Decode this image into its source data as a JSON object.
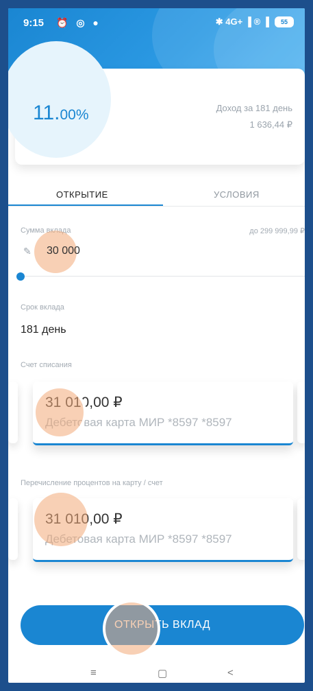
{
  "status_bar": {
    "time": "9:15",
    "left_icons": "⏰ ◎ ●",
    "right_icons": "✱ 4G+ ▐ ® ▐",
    "battery": "55"
  },
  "header": {
    "back_icon": "arrow-left-icon"
  },
  "rate_card": {
    "rate_value": "11.",
    "rate_suffix": "00%",
    "income_label": "Доход за 181 день",
    "income_value": "1 636,44 ₽"
  },
  "tabs": [
    {
      "label": "ОТКРЫТИЕ",
      "active": true
    },
    {
      "label": "УСЛОВИЯ",
      "active": false
    }
  ],
  "deposit": {
    "amount_label": "Сумма вклада",
    "amount_max": "до 299 999,99 ₽",
    "amount_value": "30 000",
    "term_label": "Срок вклада",
    "term_value": "181 день"
  },
  "debit_account": {
    "label": "Счет списания",
    "amount": "31 010,00 ₽",
    "description": "Дебетовая карта МИР *8597 *8597"
  },
  "interest_account": {
    "label": "Перечисление процентов на карту / счет",
    "amount": "31 010,00 ₽",
    "description": "Дебетовая карта МИР *8597 *8597"
  },
  "open_button": {
    "label": "ОТКРЫТЬ ВКЛАД"
  },
  "nav_bar": {
    "menu": "≡",
    "home": "▢",
    "back": "<"
  },
  "colors": {
    "accent": "#1a86d2",
    "touch": "#f2aa78"
  }
}
